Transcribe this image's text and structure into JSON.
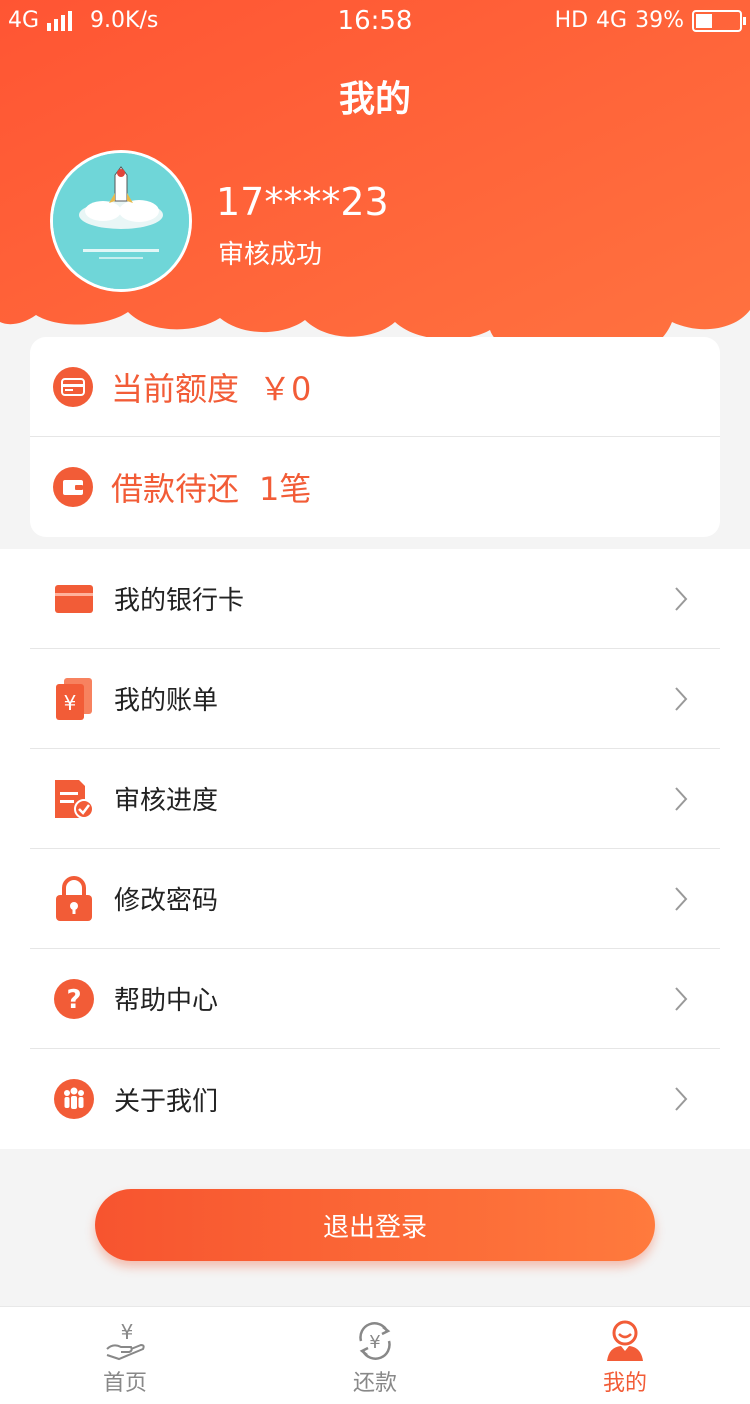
{
  "status_bar": {
    "network": "4G",
    "speed": "9.0K/s",
    "time": "16:58",
    "hd": "HD",
    "network_right": "4G",
    "battery": "39%"
  },
  "header": {
    "title": "我的",
    "phone": "17****23",
    "status": "审核成功"
  },
  "quota": {
    "credit_label": "当前额度",
    "credit_value": "￥0",
    "loan_label": "借款待还",
    "loan_value": "1笔"
  },
  "menu": [
    {
      "label": "我的银行卡",
      "icon": "bank-card-icon"
    },
    {
      "label": "我的账单",
      "icon": "bill-icon"
    },
    {
      "label": "审核进度",
      "icon": "review-progress-icon"
    },
    {
      "label": "修改密码",
      "icon": "lock-icon"
    },
    {
      "label": "帮助中心",
      "icon": "help-icon"
    },
    {
      "label": "关于我们",
      "icon": "about-us-icon"
    }
  ],
  "logout_label": "退出登录",
  "tabbar": [
    {
      "label": "首页",
      "icon": "home-yen-icon",
      "active": false
    },
    {
      "label": "还款",
      "icon": "repay-icon",
      "active": false
    },
    {
      "label": "我的",
      "icon": "profile-icon",
      "active": true
    }
  ],
  "colors": {
    "accent": "#f25c37",
    "header_gradient_start": "#ff5a35",
    "header_gradient_end": "#ff6f3c"
  }
}
